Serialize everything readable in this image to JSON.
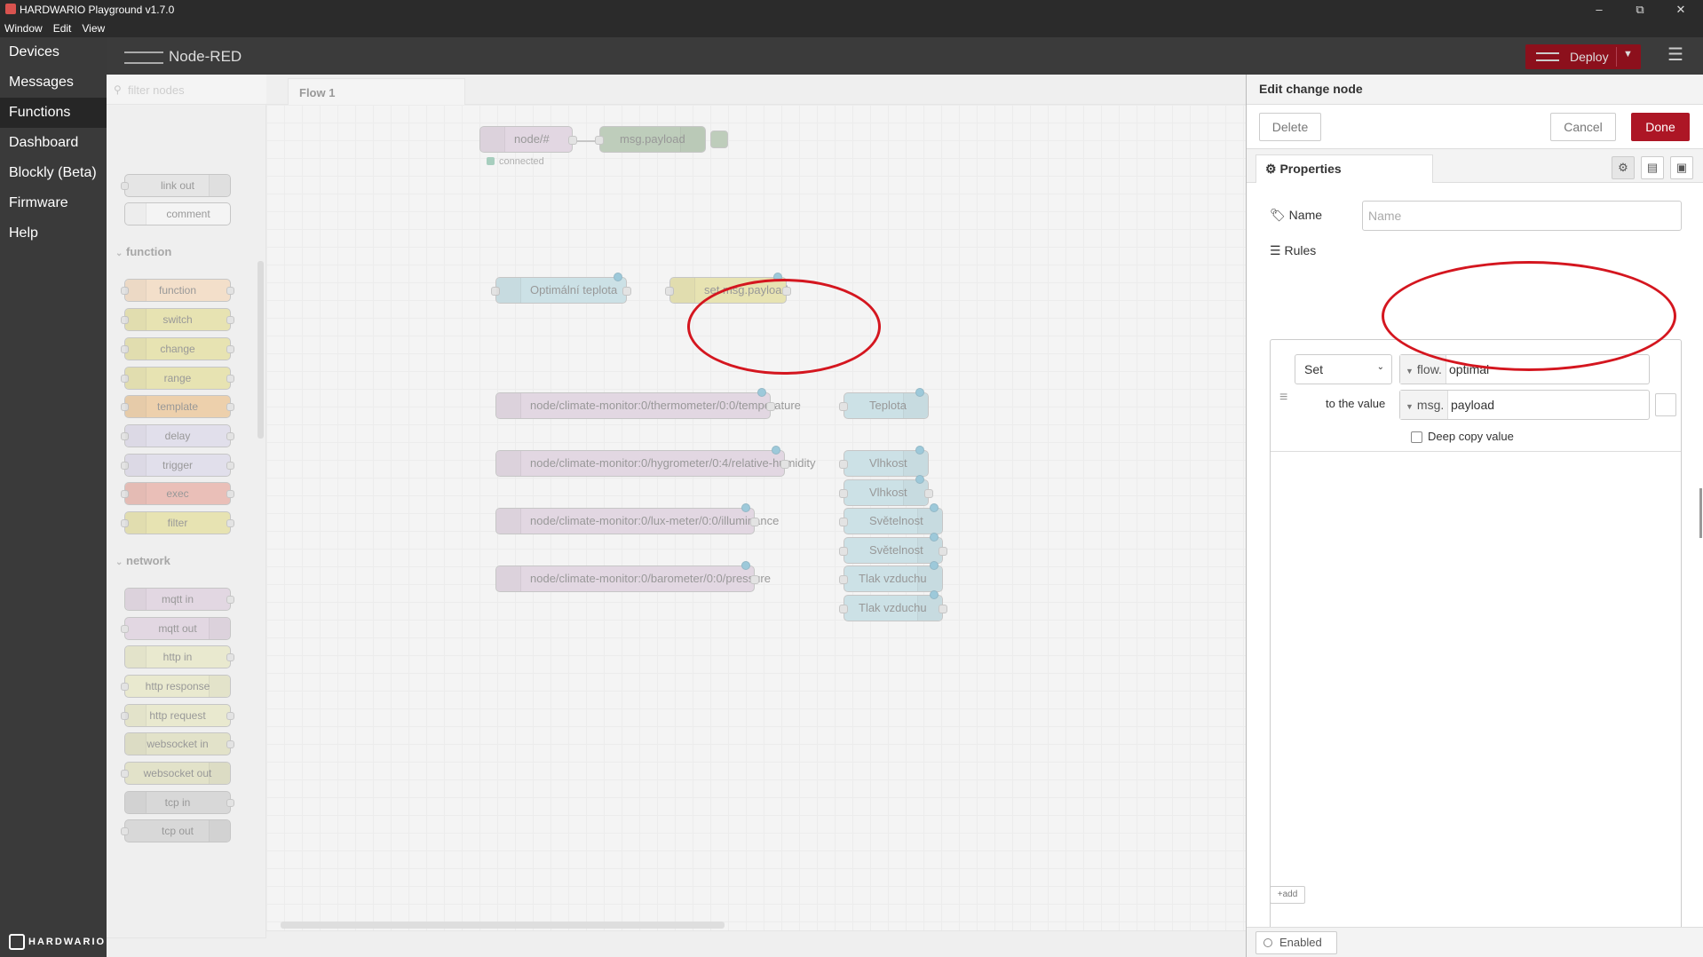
{
  "window": {
    "title": "HARDWARIO Playground v1.7.0",
    "menu": [
      "Window",
      "Edit",
      "View"
    ],
    "controls": {
      "minimize": "–",
      "maximize": "⧉",
      "close": "✕"
    }
  },
  "leftnav": {
    "items": [
      {
        "label": "Devices",
        "active": false
      },
      {
        "label": "Messages",
        "active": false
      },
      {
        "label": "Functions",
        "active": true
      },
      {
        "label": "Dashboard",
        "active": false
      },
      {
        "label": "Blockly (Beta)",
        "active": false
      },
      {
        "label": "Firmware",
        "active": false
      },
      {
        "label": "Help",
        "active": false
      }
    ],
    "brand": "HARDWARIO"
  },
  "header": {
    "app": "Node-RED",
    "deploy_label": "Deploy"
  },
  "palette": {
    "filter_placeholder": "filter nodes",
    "top_items": [
      "link out",
      "comment"
    ],
    "categories": [
      {
        "name": "function",
        "items": [
          "function",
          "switch",
          "change",
          "range",
          "template",
          "delay",
          "trigger",
          "exec",
          "filter"
        ]
      },
      {
        "name": "network",
        "items": [
          "mqtt in",
          "mqtt out",
          "http in",
          "http response",
          "http request",
          "websocket in",
          "websocket out",
          "tcp in",
          "tcp out"
        ]
      }
    ]
  },
  "workspace": {
    "tab": "Flow 1",
    "nodes": {
      "mqtt_all": "node/#",
      "mqtt_all_status": "connected",
      "debug": "msg.payload",
      "ui_optimal": "Optimální teplota",
      "change_node": "set msg.payload",
      "mqtt_temp": "node/climate-monitor:0/thermometer/0:0/temperature",
      "mqtt_hum": "node/climate-monitor:0/hygrometer/0:4/relative-humidity",
      "mqtt_lux": "node/climate-monitor:0/lux-meter/0:0/illuminance",
      "mqtt_press": "node/climate-monitor:0/barometer/0:0/pressure",
      "ui_teplota": "Teplota",
      "ui_vlhkost_gauge": "Vlhkost",
      "ui_vlhkost_chart": "Vlhkost",
      "ui_svetelnost_gauge": "Světelnost",
      "ui_svetelnost_chart": "Světelnost",
      "ui_tlak_gauge": "Tlak vzduchu",
      "ui_tlak_chart": "Tlak vzduchu"
    }
  },
  "editor": {
    "title": "Edit change node",
    "delete": "Delete",
    "cancel": "Cancel",
    "done": "Done",
    "tab_properties": "Properties",
    "name_label": "Name",
    "name_placeholder": "Name",
    "rules_label": "Rules",
    "rule": {
      "action": "Set",
      "target_type": "flow.",
      "target_value": "optimal",
      "to_label": "to the value",
      "source_type": "msg.",
      "source_value": "payload",
      "deep_copy": "Deep copy value"
    },
    "add": "add",
    "enabled": "Enabled"
  },
  "colors": {
    "accent": "#ad1625",
    "highlight": "#d4161f"
  }
}
